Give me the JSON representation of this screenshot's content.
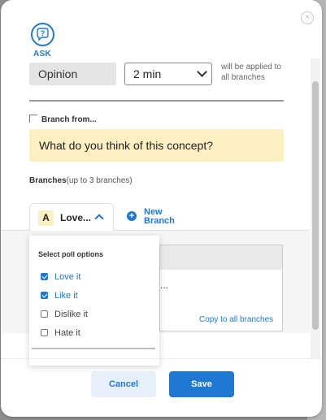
{
  "header": {
    "ask_label": "ASK",
    "close_icon": "close-circle-icon"
  },
  "question_type": {
    "value": "Opinion"
  },
  "time_select": {
    "value": "2 min"
  },
  "apply_note": "will be applied to all branches",
  "branch_from": {
    "label": "Branch from...",
    "question": "What do you think of this concept?"
  },
  "branches": {
    "label": "Branches",
    "hint": "(up to 3 branches)"
  },
  "tab_a": {
    "letter": "A",
    "name": "Love..."
  },
  "new_branch": {
    "plus": "+",
    "label": "New Branch"
  },
  "poll_dropdown": {
    "title": "Select poll options",
    "options": [
      {
        "label": "Love it",
        "checked": true
      },
      {
        "label": "Like it",
        "checked": true
      },
      {
        "label": "Dislike it",
        "checked": false
      },
      {
        "label": "Hate it",
        "checked": false
      }
    ]
  },
  "table_body": {
    "ellipsis": "..."
  },
  "copy_link": "Copy to all branches",
  "footer": {
    "cancel_label": "Cancel",
    "save_label": "Save"
  },
  "colors": {
    "accent": "#1f78d1",
    "highlight": "#fcefc2"
  }
}
